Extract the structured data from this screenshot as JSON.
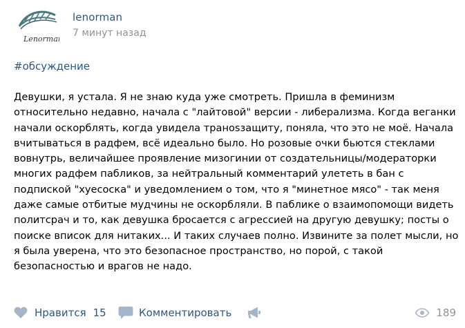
{
  "author": {
    "name": "lenorman",
    "avatar_logo_text": "Lenorman"
  },
  "post": {
    "timestamp": "7 минут назад",
    "hashtag": "#обсуждение",
    "text": "Девушки, я устала. Я не знаю куда уже смотреть. Пришла в феминизм\nотносительно недавно, начала с \"лайтовой\" версии - либерализма. Когда веганки\nначали оскорблять, когда увидела транosзащиту, поняла, что это не моё. Начала\nвчитываться в радфем, всё идеально было. Но розовые очки бьются стеклами\nвовнутрь, величайшее проявление мизогинии от создательницы/модераторки\nмногих радфем пабликов, за нейтральный комментарий улететь в бан с\nподпиской \"хуесоска\" и уведомлением о том, что я \"минетное мясо\" - так меня\nдаже самые отбитые мудчины не оскорбляли. В паблике о взаимопомощи видеть\nполитсрач и то, как девушка бросается с агрессией на другую девушку; посты о\nпоиске вписок для нитаких... И таких случаев полно. Извините за полет мысли, но\nя была уверена, что это безопасное пространство, но порой, с такой\nбезопасностью и врагов не надо."
  },
  "actions": {
    "like_label": "Нравится",
    "like_count": "15",
    "comment_label": "Комментировать",
    "views_count": "189"
  },
  "colors": {
    "link": "#2a5885",
    "muted": "#939393",
    "icon": "#a6b6c9",
    "logo": "#4a7a80"
  }
}
